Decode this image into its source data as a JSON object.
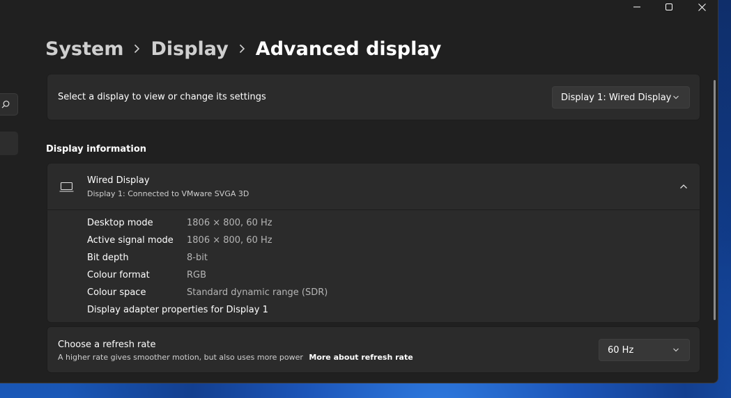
{
  "breadcrumb": {
    "items": [
      "System",
      "Display"
    ],
    "current": "Advanced display"
  },
  "display_selector": {
    "label": "Select a display to view or change its settings",
    "value": "Display 1: Wired Display"
  },
  "display_information": {
    "section_title": "Display information",
    "monitor_name": "Wired Display",
    "monitor_subtitle": "Display 1: Connected to VMware SVGA 3D",
    "rows": [
      {
        "key": "Desktop mode",
        "value": "1806 × 800, 60 Hz"
      },
      {
        "key": "Active signal mode",
        "value": "1806 × 800, 60 Hz"
      },
      {
        "key": "Bit depth",
        "value": "8-bit"
      },
      {
        "key": "Colour format",
        "value": "RGB"
      },
      {
        "key": "Colour space",
        "value": "Standard dynamic range (SDR)"
      }
    ],
    "adapter_link": "Display adapter properties for Display 1"
  },
  "refresh_rate": {
    "title": "Choose a refresh rate",
    "description": "A higher rate gives smoother motion, but also uses more power",
    "link": "More about refresh rate",
    "value": "60 Hz"
  },
  "icons": {
    "search": "search-icon",
    "minimize": "minimize-icon",
    "maximize": "maximize-icon",
    "close": "close-icon",
    "chevron_right": "chevron-right-icon",
    "chevron_down": "chevron-down-icon",
    "chevron_up": "chevron-up-icon",
    "monitor": "laptop-icon"
  },
  "colors": {
    "window_bg": "#202020",
    "card_bg": "#2b2b2b",
    "control_bg": "#373737"
  }
}
